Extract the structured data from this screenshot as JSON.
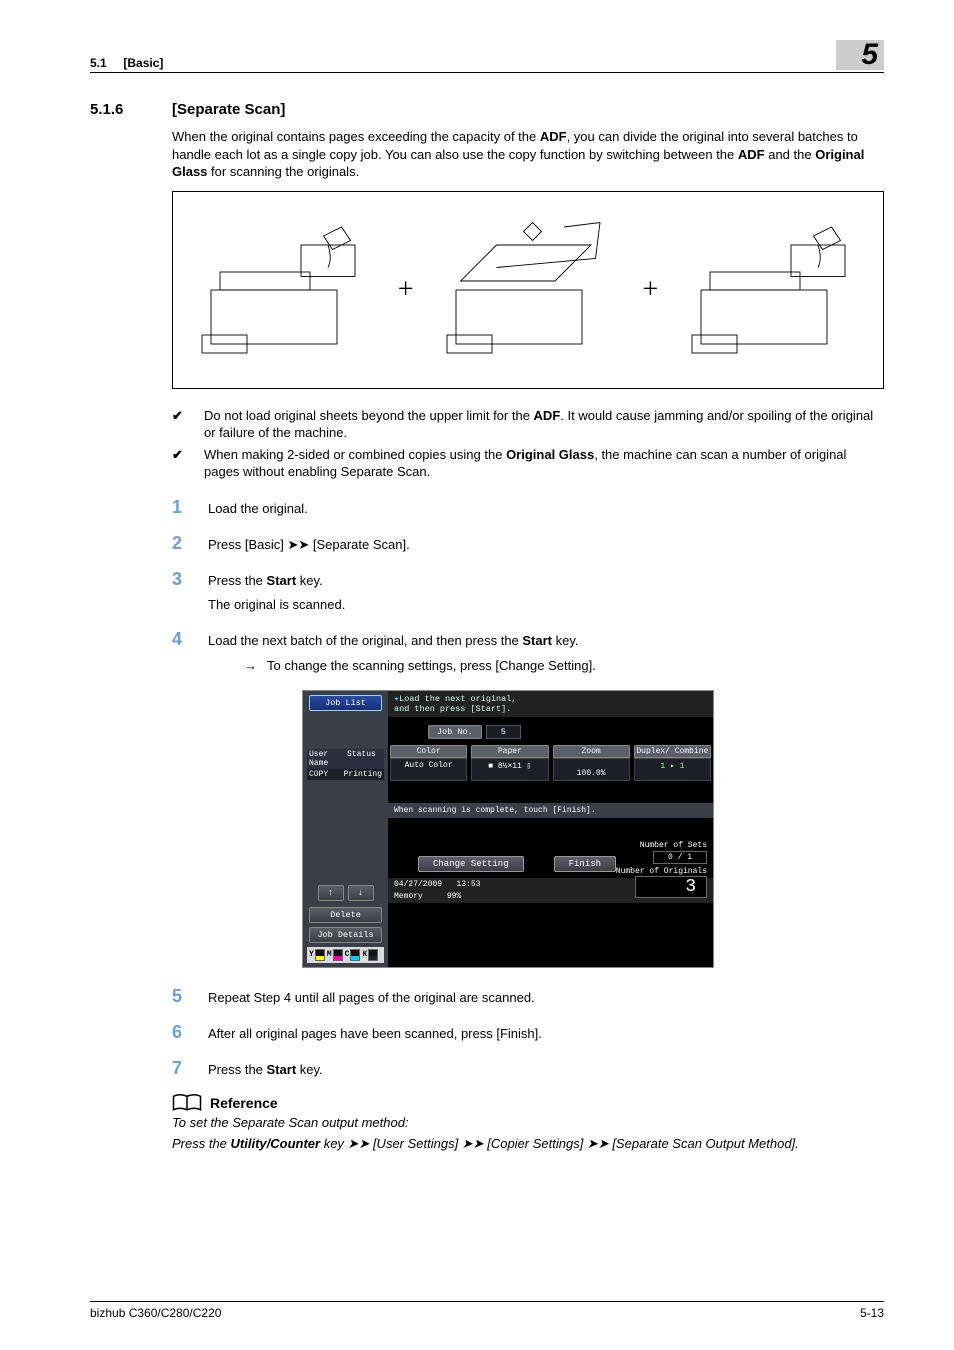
{
  "header": {
    "section_ref": "5.1",
    "section_ref_title": "[Basic]",
    "chapter_num": "5"
  },
  "section": {
    "number": "5.1.6",
    "title": "[Separate Scan]"
  },
  "intro": {
    "t1": "When the original contains pages exceeding the capacity of the ",
    "b1": "ADF",
    "t2": ", you can divide the original into several batches to handle each lot as a single copy job. You can also use the copy function by switching between the ",
    "b2": "ADF",
    "t3": " and the ",
    "b3": "Original Glass",
    "t4": " for scanning the originals."
  },
  "checks": {
    "c1a": "Do not load original sheets beyond the upper limit for the ",
    "c1b": "ADF",
    "c1c": ". It would cause jamming and/or spoiling of the original or failure of the machine.",
    "c2a": "When making 2-sided or combined copies using the ",
    "c2b": "Original Glass",
    "c2c": ", the machine can scan a number of original pages without enabling Separate Scan."
  },
  "steps": {
    "s1": "Load the original.",
    "s2": "Press [Basic] ➤➤ [Separate Scan].",
    "s3a": "Press the ",
    "s3b": "Start",
    "s3c": " key.",
    "s3d": "The original is scanned.",
    "s4a": "Load the next batch of the original, and then press the ",
    "s4b": "Start",
    "s4c": " key.",
    "s4sub": "To change the scanning settings, press [Change Setting].",
    "s5": "Repeat Step 4 until all pages of the original are scanned.",
    "s6": "After all original pages have been scanned, press [Finish].",
    "s7a": "Press the ",
    "s7b": "Start",
    "s7c": " key."
  },
  "screen": {
    "job_list": "Job List",
    "msg1": "Load the next original,",
    "msg2": "and then press [Start].",
    "jobno_lbl": "Job No.",
    "jobno_val": "5",
    "hdr": {
      "c1": "Color",
      "c2": "Paper",
      "c3": "Zoom",
      "c4": "Duplex/\nCombine"
    },
    "val": {
      "c1": "Auto Color",
      "c2": "■ 8½×11 ▯",
      "c3": "100.0%",
      "c4": "1 ▸ 1"
    },
    "left_hdr_a": "User\nName",
    "left_hdr_b": "Status",
    "left_val_a": "COPY",
    "left_val_b": "Printing",
    "mid_msg": "When scanning is complete, touch [Finish].",
    "sets_lbl": "Number of Sets",
    "sets_val": "0 / 1",
    "orig_lbl": "Number of Originals",
    "orig_val": "3",
    "delete": "Delete",
    "job_details": "Job Details",
    "change_setting": "Change Setting",
    "finish": "Finish",
    "date": "04/27/2009",
    "time": "13:53",
    "mem_lbl": "Memory",
    "mem_val": "99%",
    "toner": {
      "y": "Y",
      "m": "M",
      "c": "C",
      "k": "K"
    }
  },
  "reference": {
    "title": "Reference",
    "line1": "To set the Separate Scan output method:",
    "line2a": "Press the ",
    "line2b": "Utility/Counter",
    "line2c": " key ➤➤ [User Settings] ➤➤ [Copier Settings] ➤➤ [Separate Scan Output Method]."
  },
  "footer": {
    "left": "bizhub C360/C280/C220",
    "right": "5-13"
  }
}
